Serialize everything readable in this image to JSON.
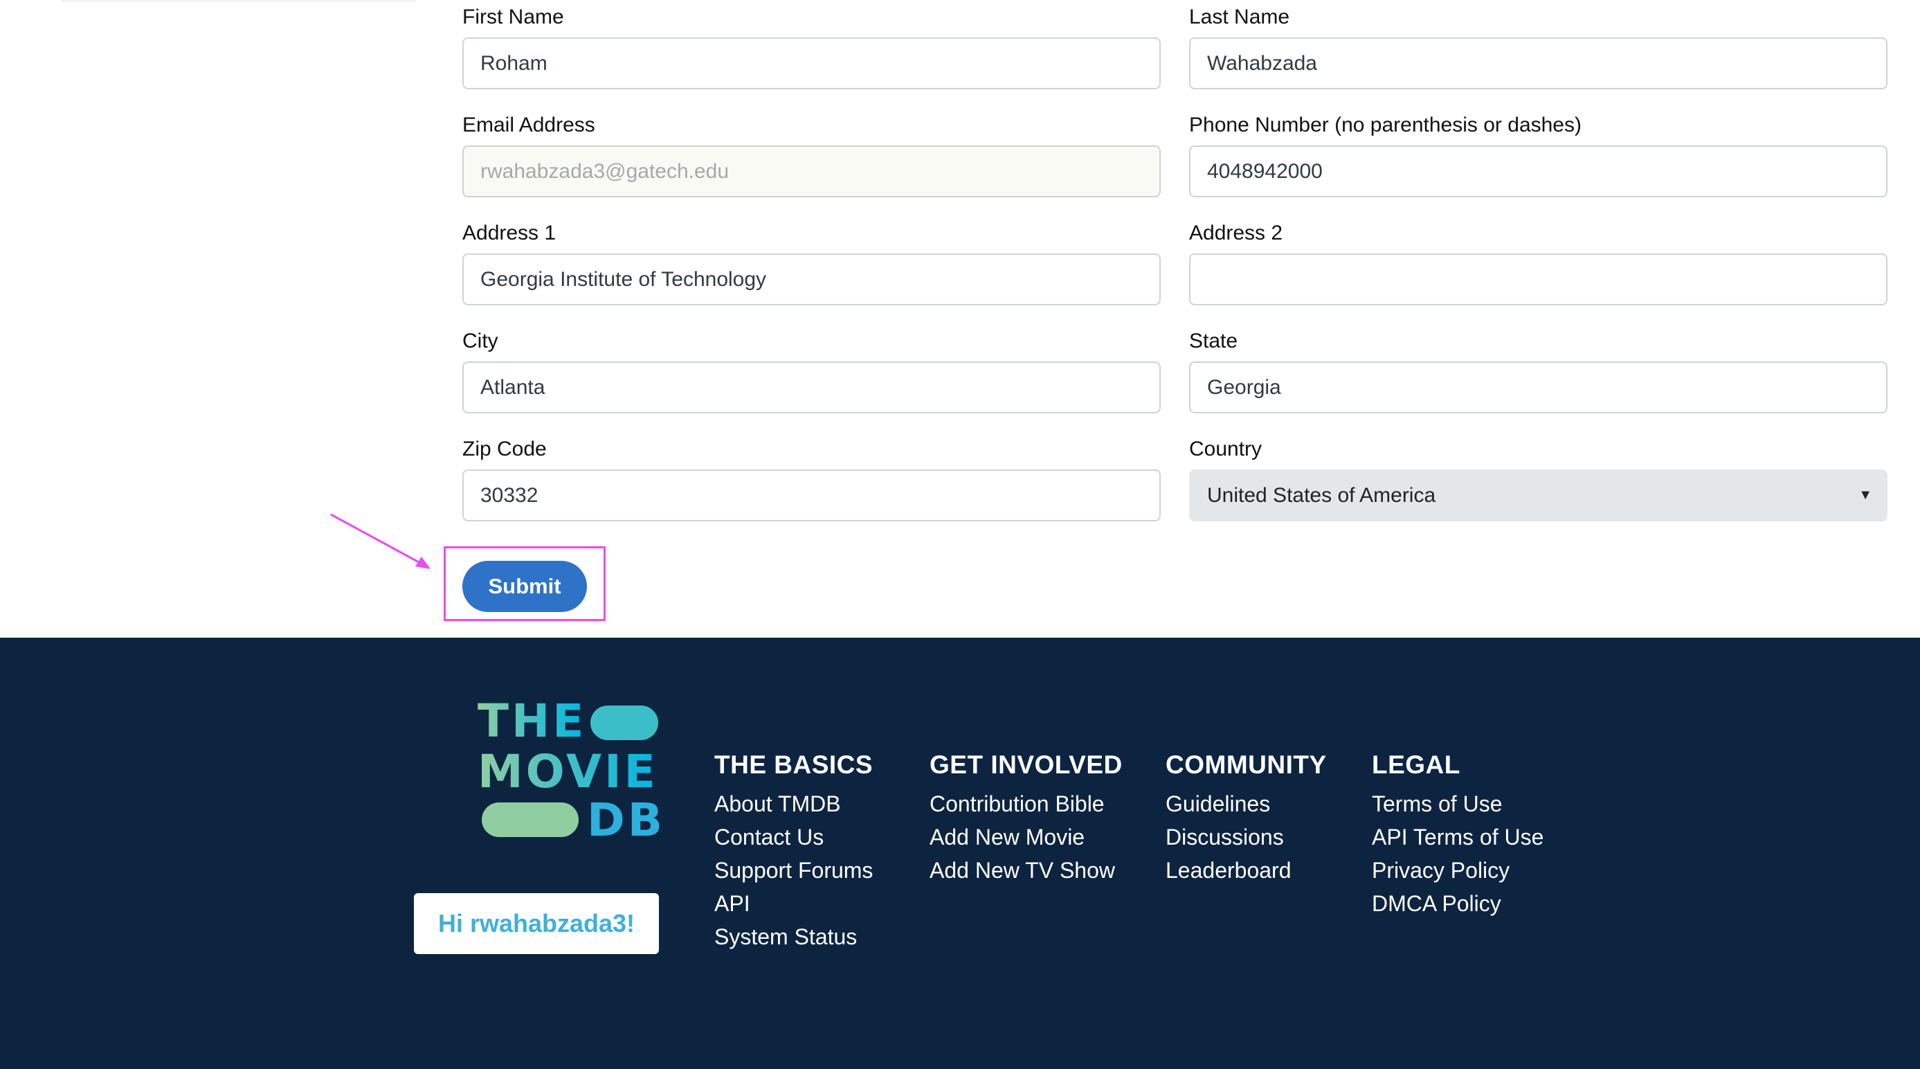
{
  "form": {
    "first_name": {
      "label": "First Name",
      "value": "Roham"
    },
    "last_name": {
      "label": "Last Name",
      "value": "Wahabzada"
    },
    "email": {
      "label": "Email Address",
      "value": "rwahabzada3@gatech.edu"
    },
    "phone": {
      "label": "Phone Number (no parenthesis or dashes)",
      "value": "4048942000"
    },
    "address1": {
      "label": "Address 1",
      "value": "Georgia Institute of Technology"
    },
    "address2": {
      "label": "Address 2",
      "value": ""
    },
    "city": {
      "label": "City",
      "value": "Atlanta"
    },
    "state": {
      "label": "State",
      "value": "Georgia"
    },
    "zip": {
      "label": "Zip Code",
      "value": "30332"
    },
    "country": {
      "label": "Country",
      "value": "United States of America"
    },
    "submit_label": "Submit"
  },
  "colors": {
    "submit_button": "#2e73c8",
    "highlight": "#e94cf0",
    "footer_bg": "#0d2441",
    "greeting_text": "#3fb0d8"
  },
  "footer": {
    "logo": {
      "line1": "THE",
      "line2": "MOVIE",
      "line3": "DB"
    },
    "greeting": "Hi rwahabzada3!",
    "columns": [
      {
        "title": "THE BASICS",
        "links": [
          "About TMDB",
          "Contact Us",
          "Support Forums",
          "API",
          "System Status"
        ]
      },
      {
        "title": "GET INVOLVED",
        "links": [
          "Contribution Bible",
          "Add New Movie",
          "Add New TV Show"
        ]
      },
      {
        "title": "COMMUNITY",
        "links": [
          "Guidelines",
          "Discussions",
          "Leaderboard"
        ]
      },
      {
        "title": "LEGAL",
        "links": [
          "Terms of Use",
          "API Terms of Use",
          "Privacy Policy",
          "DMCA Policy"
        ]
      }
    ]
  }
}
